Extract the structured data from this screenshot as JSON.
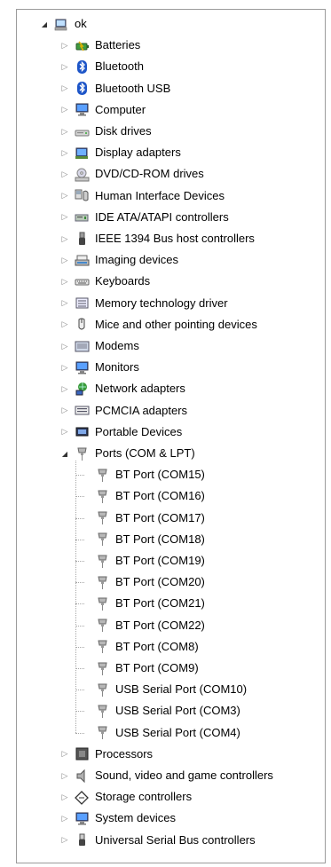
{
  "root": {
    "label": "ok",
    "icon": "computer-icon",
    "expanded": true
  },
  "categories": [
    {
      "label": "Batteries",
      "icon": "battery-icon"
    },
    {
      "label": "Bluetooth",
      "icon": "bluetooth-icon"
    },
    {
      "label": "Bluetooth USB",
      "icon": "bluetooth-icon"
    },
    {
      "label": "Computer",
      "icon": "monitor-icon"
    },
    {
      "label": "Disk drives",
      "icon": "disk-drive-icon"
    },
    {
      "label": "Display adapters",
      "icon": "display-adapter-icon"
    },
    {
      "label": "DVD/CD-ROM drives",
      "icon": "dvd-drive-icon"
    },
    {
      "label": "Human Interface Devices",
      "icon": "hid-icon"
    },
    {
      "label": "IDE ATA/ATAPI controllers",
      "icon": "ide-controller-icon"
    },
    {
      "label": "IEEE 1394 Bus host controllers",
      "icon": "ieee1394-icon"
    },
    {
      "label": "Imaging devices",
      "icon": "scanner-icon"
    },
    {
      "label": "Keyboards",
      "icon": "keyboard-icon"
    },
    {
      "label": "Memory technology driver",
      "icon": "memory-card-icon"
    },
    {
      "label": "Mice and other pointing devices",
      "icon": "mouse-icon"
    },
    {
      "label": "Modems",
      "icon": "modem-icon"
    },
    {
      "label": "Monitors",
      "icon": "monitor-icon"
    },
    {
      "label": "Network adapters",
      "icon": "network-icon"
    },
    {
      "label": "PCMCIA adapters",
      "icon": "pcmcia-icon"
    },
    {
      "label": "Portable Devices",
      "icon": "portable-device-icon"
    },
    {
      "label": "Ports (COM & LPT)",
      "icon": "port-icon",
      "expanded": true,
      "children": [
        "BT Port (COM15)",
        "BT Port (COM16)",
        "BT Port (COM17)",
        "BT Port (COM18)",
        "BT Port (COM19)",
        "BT Port (COM20)",
        "BT Port (COM21)",
        "BT Port (COM22)",
        "BT Port (COM8)",
        "BT Port (COM9)",
        "USB Serial Port (COM10)",
        "USB Serial Port (COM3)",
        "USB Serial Port (COM4)"
      ]
    },
    {
      "label": "Processors",
      "icon": "processor-icon"
    },
    {
      "label": "Sound, video and game controllers",
      "icon": "speaker-icon"
    },
    {
      "label": "Storage controllers",
      "icon": "storage-controller-icon"
    },
    {
      "label": "System devices",
      "icon": "monitor-icon"
    },
    {
      "label": "Universal Serial Bus controllers",
      "icon": "usb-icon"
    }
  ],
  "glyphs": {
    "expanded": "◢",
    "collapsed": "▷"
  }
}
